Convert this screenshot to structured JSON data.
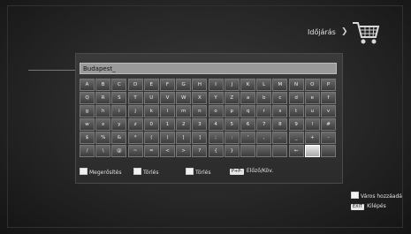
{
  "header": {
    "title": "Időjárás",
    "arrow": "❯",
    "icon": "shopping-cart-icon"
  },
  "input": {
    "value": "Budapest_"
  },
  "keyboard": {
    "rows": [
      [
        "A",
        "B",
        "C",
        "D",
        "E",
        "F",
        "G",
        "H",
        "I",
        "J",
        "K",
        "L",
        "M",
        "N",
        "O",
        "P"
      ],
      [
        "Q",
        "R",
        "S",
        "T",
        "U",
        "V",
        "W",
        "X",
        "Y",
        "Z",
        "a",
        "b",
        "c",
        "d",
        "e",
        "f"
      ],
      [
        "g",
        "h",
        "i",
        "j",
        "k",
        "l",
        "m",
        "n",
        "o",
        "p",
        "q",
        "r",
        "s",
        "t",
        "u",
        "v"
      ],
      [
        "w",
        "x",
        "y",
        "z",
        "0",
        "1",
        "2",
        "3",
        "4",
        "5",
        "6",
        "7",
        "8",
        "9",
        "!",
        "#"
      ],
      [
        "$",
        "%",
        "&",
        "*",
        "(",
        ")",
        "[",
        "]",
        ";",
        ":",
        "'",
        ",",
        ".",
        "_",
        "+",
        "-"
      ],
      [
        "/",
        "\\",
        "@",
        "~",
        "=",
        "<",
        ">",
        "?",
        "{",
        "}",
        "",
        "",
        "",
        "←",
        "",
        ""
      ]
    ],
    "selected_row": 5,
    "selected_col": 14
  },
  "legend": [
    {
      "label": "Megerősítés",
      "kind": "square"
    },
    {
      "label": "Törlés",
      "kind": "square"
    },
    {
      "label": "Törlés",
      "kind": "square"
    },
    {
      "label": "Előző/Köv.",
      "kind": "badge",
      "badge": "P+P-"
    }
  ],
  "side": {
    "add_city": "Város hozzáadá",
    "exit_badge": "EXIT",
    "exit": "Kilépés"
  }
}
